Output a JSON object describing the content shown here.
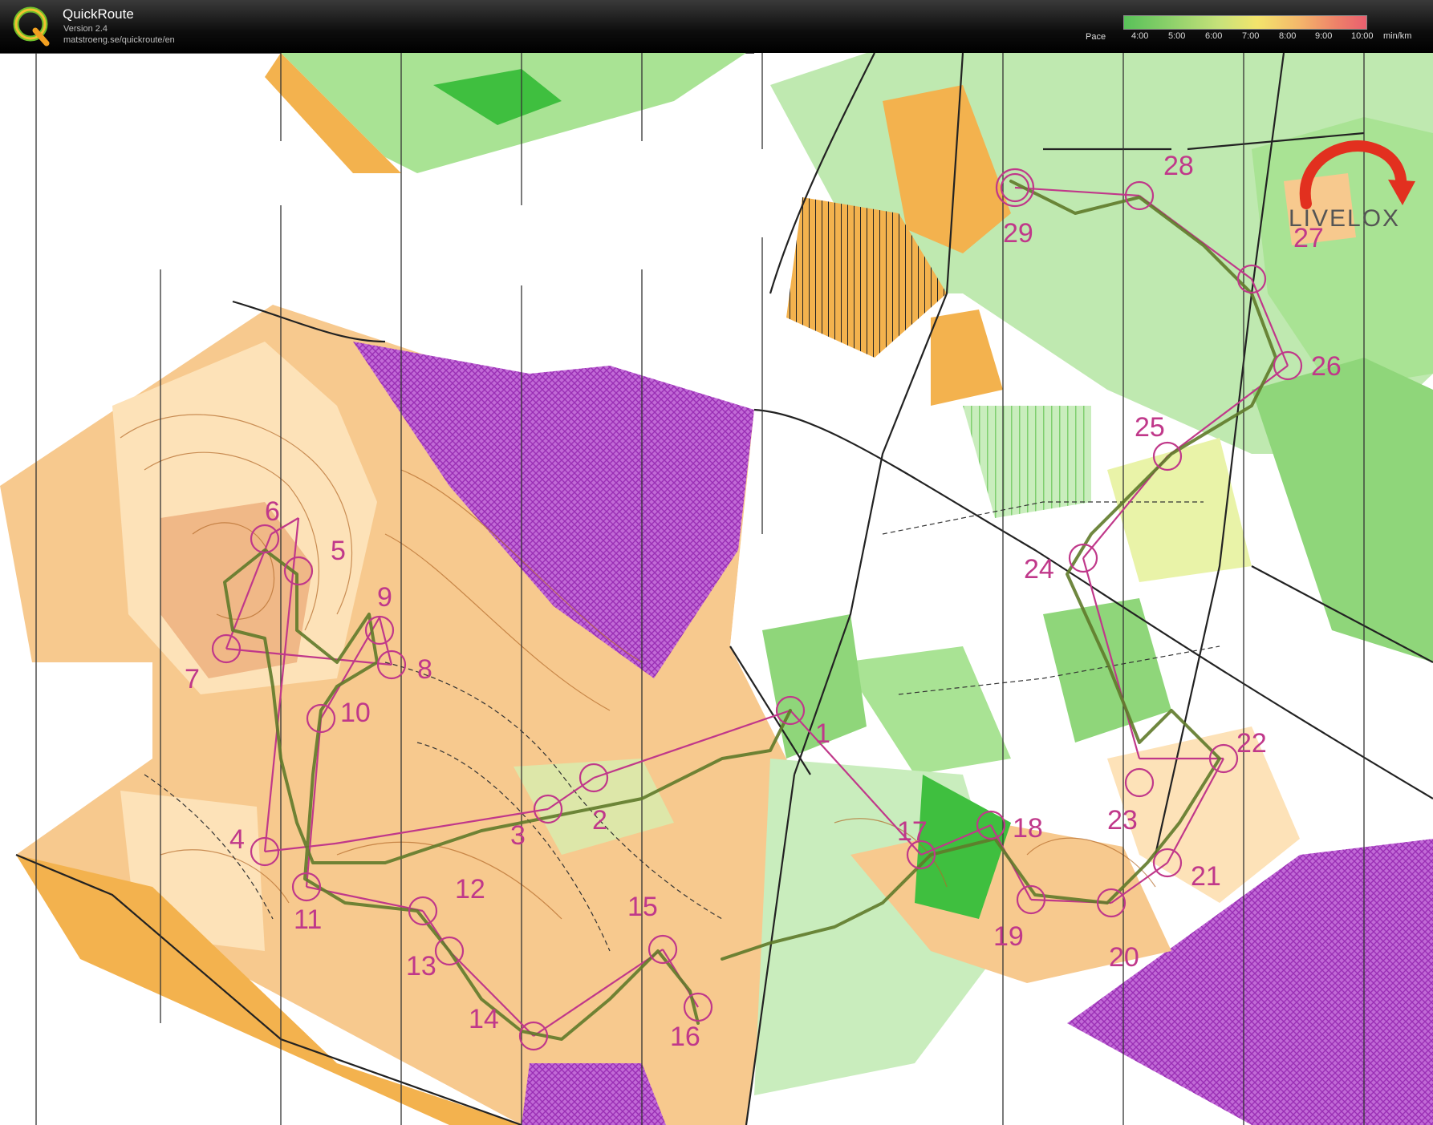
{
  "app": {
    "title": "QuickRoute",
    "version": "Version 2.4",
    "url": "matstroeng.se/quickroute/en"
  },
  "pace_legend": {
    "label": "Pace",
    "ticks": [
      "4:00",
      "5:00",
      "6:00",
      "7:00",
      "8:00",
      "9:00",
      "10:00"
    ],
    "unit": "min/km",
    "colors": [
      "#59c159",
      "#8fd16b",
      "#c9e27a",
      "#f3e46c",
      "#f4b86b",
      "#ee8069",
      "#e95f6f"
    ]
  },
  "watermark": {
    "text": "LIVELOX",
    "icon": "livelox-arrow-icon"
  },
  "map": {
    "colors": {
      "open_land": "#f7c98e",
      "rough_open": "#fde2b8",
      "forest_green": "#8fd67a",
      "dense_green": "#3fbf3f",
      "field_yellow": "#f3b24e",
      "forbidden": "#b04ec9",
      "contour": "#b46a2a",
      "course": "#c0388a",
      "route": "#5f7a2a"
    },
    "controls": [
      {
        "number": "1"
      },
      {
        "number": "2"
      },
      {
        "number": "3"
      },
      {
        "number": "4"
      },
      {
        "number": "5"
      },
      {
        "number": "6"
      },
      {
        "number": "7"
      },
      {
        "number": "8"
      },
      {
        "number": "9"
      },
      {
        "number": "10"
      },
      {
        "number": "11"
      },
      {
        "number": "12"
      },
      {
        "number": "13"
      },
      {
        "number": "14"
      },
      {
        "number": "15"
      },
      {
        "number": "16"
      },
      {
        "number": "17"
      },
      {
        "number": "18"
      },
      {
        "number": "19"
      },
      {
        "number": "20"
      },
      {
        "number": "21"
      },
      {
        "number": "22"
      },
      {
        "number": "23"
      },
      {
        "number": "24"
      },
      {
        "number": "25"
      },
      {
        "number": "26"
      },
      {
        "number": "27"
      },
      {
        "number": "28"
      },
      {
        "number": "29"
      }
    ]
  }
}
